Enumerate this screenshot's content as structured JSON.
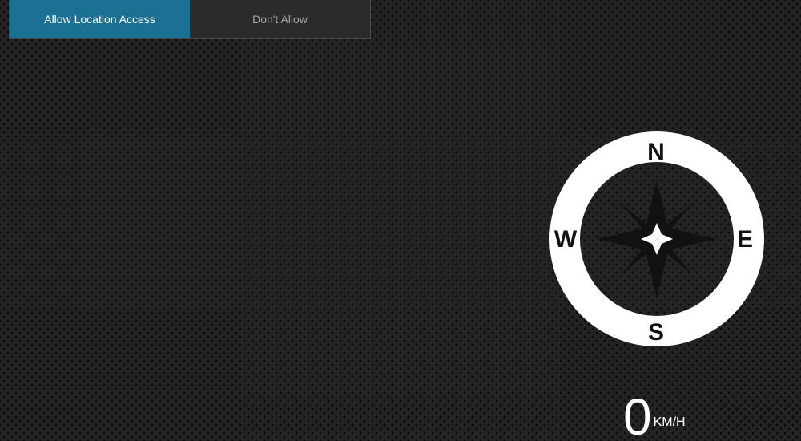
{
  "permission_prompt": {
    "allow_label": "Allow Location Access",
    "deny_label": "Don't Allow",
    "colors": {
      "allow_bg": "#1b7193",
      "bar_bg": "#2b2b2b"
    }
  },
  "compass": {
    "north": "N",
    "east": "E",
    "south": "S",
    "west": "W",
    "icon": "compass-rose-icon"
  },
  "speedometer": {
    "value": "0",
    "unit": "KM/H"
  }
}
